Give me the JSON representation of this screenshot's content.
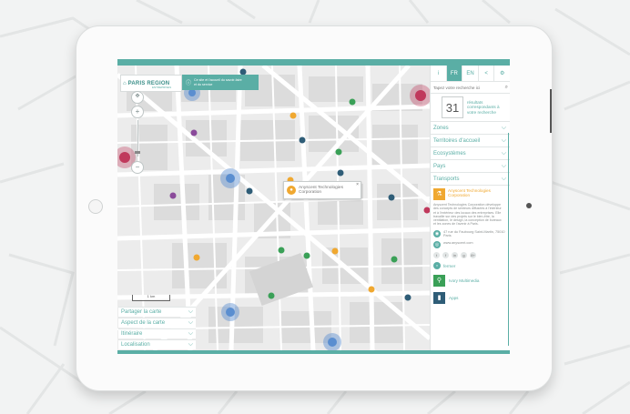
{
  "colors": {
    "accent": "#5aaea5",
    "orange": "#f0a830",
    "green": "#3aa057",
    "dark_blue": "#2f5d77",
    "purple": "#8a4a9a"
  },
  "header": {
    "logo_text": "PARIS REGION",
    "logo_sub": "ENTREPRISES",
    "tour_text": "Ce site et l'accueil du savoir-faire et du service"
  },
  "map": {
    "zoom_in": "+",
    "zoom_out": "−",
    "scale_label": "1 km",
    "popup": {
      "name": "Anyscent Technologies Corporation",
      "close": "×",
      "icon": "pin-icon"
    }
  },
  "map_menu": [
    {
      "label": "Partager la carte"
    },
    {
      "label": "Aspect de la carte"
    },
    {
      "label": "Itinéraire"
    },
    {
      "label": "Localisation"
    }
  ],
  "panel": {
    "tabs": [
      {
        "label": "i"
      },
      {
        "label": "FR"
      },
      {
        "label": "EN"
      },
      {
        "label": "<"
      },
      {
        "label": "⚙"
      }
    ],
    "search_placeholder": "Tapez votre recherche ici",
    "count": {
      "number": "31",
      "description": "résultats correspondants à votre recherche"
    },
    "filters": [
      {
        "label": "Zones"
      },
      {
        "label": "Territoires d'accueil"
      },
      {
        "label": "Ecosystèmes"
      },
      {
        "label": "Pays"
      },
      {
        "label": "Transports"
      }
    ],
    "detail": {
      "name": "Anyscent Technologies Corporation",
      "body": "Anyscent Technologies Corporation développe des concepts de senteurs diffusées à l'intérieur et à l'extérieur des locaux des entreprises. Elle travaille sur des projets sur le bien-être, la ventilation, le design, la conception de bureaux et les zones de l'avenir à Paris.",
      "address": "47 rue du Faubourg Saint-Martin, 75010 Paris",
      "website": "www.anyscent.com",
      "social": [
        "t",
        "f",
        "in",
        "g",
        "8+"
      ],
      "close_label": "fermer"
    },
    "related": [
      {
        "name": "Ivory Multimedia"
      },
      {
        "name": "Apps"
      }
    ]
  }
}
